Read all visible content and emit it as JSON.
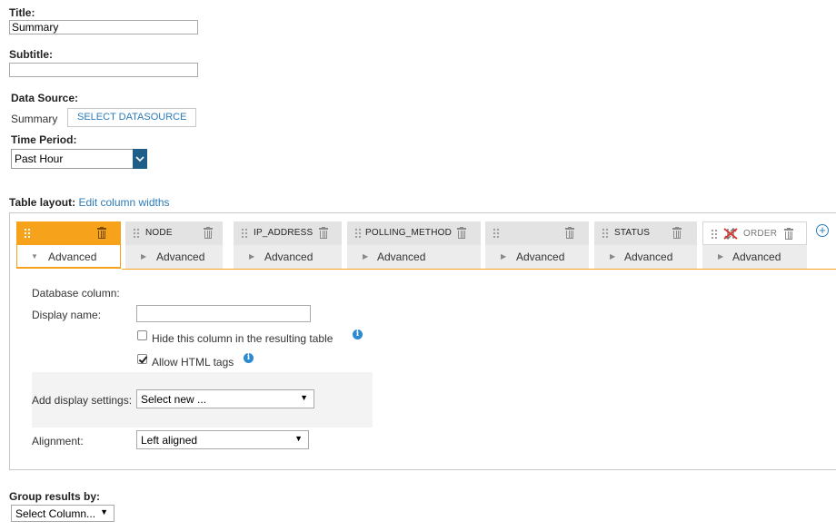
{
  "title_field": {
    "label": "Title:",
    "value": "Summary"
  },
  "subtitle_field": {
    "label": "Subtitle:",
    "value": ""
  },
  "data_source": {
    "label": "Data Source:",
    "current": "Summary",
    "button": "SELECT DATASOURCE"
  },
  "time_period": {
    "label": "Time Period:",
    "selected": "Past Hour"
  },
  "table_layout": {
    "label": "Table layout:",
    "edit_link": "Edit column widths",
    "columns": [
      {
        "name": "",
        "advanced": "Advanced"
      },
      {
        "name": "NODE",
        "advanced": "Advanced"
      },
      {
        "name": "IP_ADDRESS",
        "advanced": "Advanced"
      },
      {
        "name": "POLLING_METHOD",
        "advanced": "Advanced"
      },
      {
        "name": "",
        "advanced": "Advanced"
      },
      {
        "name": "STATUS",
        "advanced": "Advanced"
      },
      {
        "name": "ORDER",
        "advanced": "Advanced"
      }
    ]
  },
  "details": {
    "db_column_label": "Database column:",
    "display_name_label": "Display name:",
    "display_name_value": "",
    "hide_column_label": "Hide this column in the resulting table",
    "hide_column_checked": false,
    "allow_html_label": "Allow HTML tags",
    "allow_html_checked": true,
    "display_settings_label": "Add display settings:",
    "display_settings_selected": "Select new ...",
    "alignment_label": "Alignment:",
    "alignment_selected": "Left aligned"
  },
  "group_by": {
    "label": "Group results by:",
    "selected": "Select Column..."
  },
  "colors": {
    "accent": "#f7a21b",
    "link": "#2b7bb9",
    "dropdown_button": "#1f5f87"
  }
}
